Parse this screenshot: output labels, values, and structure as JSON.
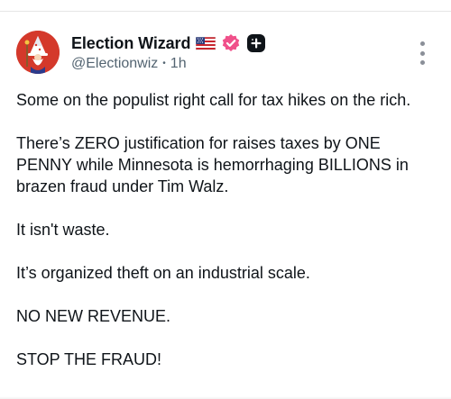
{
  "author": {
    "display_name": "Election Wizard",
    "handle": "@Electionwiz",
    "time_sep": "•",
    "time": "1h",
    "badges": [
      "us-flag-icon",
      "verified-badge-icon",
      "plus-badge-icon"
    ]
  },
  "post": {
    "paragraphs": [
      "Some on the populist right call for tax hikes on the rich.",
      "There’s ZERO justification for raises taxes by ONE PENNY while Minnesota is hemorrhaging BILLIONS in brazen fraud under Tim Walz.",
      "It isn't waste.",
      "It’s organized theft on an industrial scale.",
      "NO NEW REVENUE.",
      "STOP THE FRAUD!"
    ]
  },
  "colors": {
    "avatar_bg": "#d4392b",
    "verified_badge": "#f0508a",
    "text_primary": "#0f1419",
    "text_secondary": "#536471"
  }
}
